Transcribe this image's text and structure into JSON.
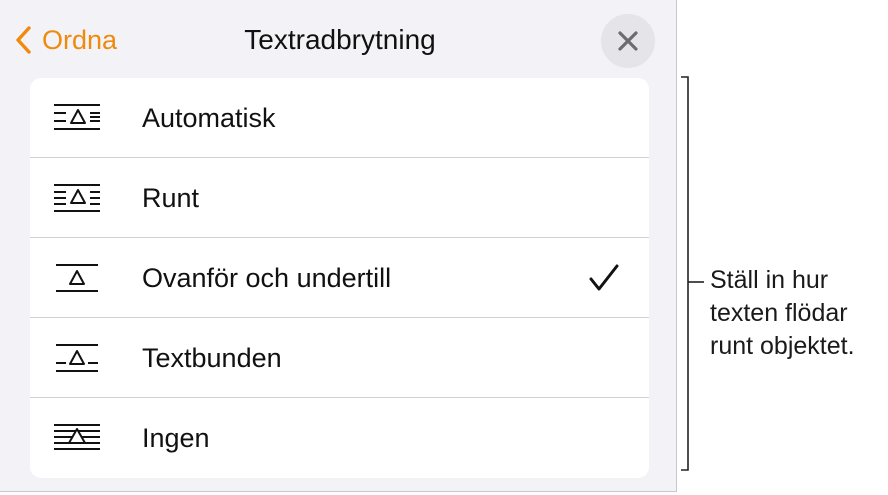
{
  "header": {
    "back_label": "Ordna",
    "title": "Textradbrytning"
  },
  "options": [
    {
      "label": "Automatisk",
      "icon": "wrap-automatic-icon",
      "selected": false
    },
    {
      "label": "Runt",
      "icon": "wrap-around-icon",
      "selected": false
    },
    {
      "label": "Ovanför och undertill",
      "icon": "wrap-above-below-icon",
      "selected": true
    },
    {
      "label": "Textbunden",
      "icon": "wrap-inline-icon",
      "selected": false
    },
    {
      "label": "Ingen",
      "icon": "wrap-none-icon",
      "selected": false
    }
  ],
  "callout": {
    "lines": [
      "Ställ in hur",
      "texten flödar",
      "runt objektet."
    ]
  },
  "colors": {
    "accent": "#ef8a0d",
    "panel_background": "#f2f2f7",
    "list_background": "#ffffff",
    "close_button_background": "#e4e4e9"
  }
}
